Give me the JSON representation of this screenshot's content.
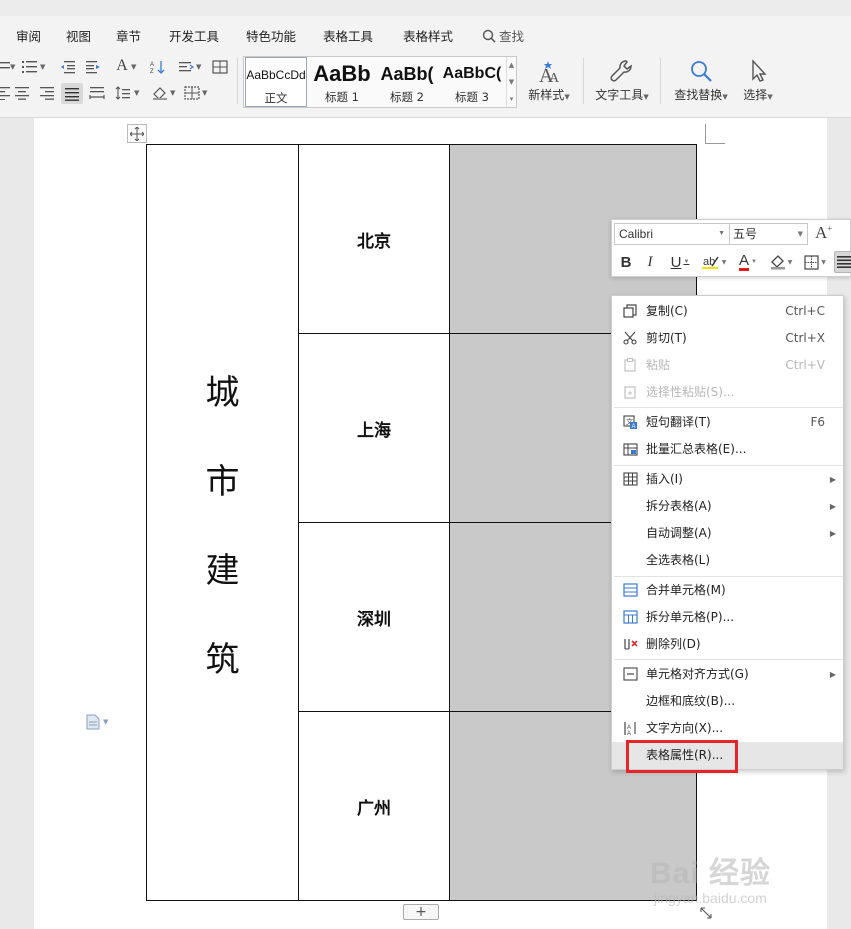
{
  "menu": {
    "tabs": [
      "审阅",
      "视图",
      "章节",
      "开发工具",
      "特色功能",
      "表格工具",
      "表格样式"
    ],
    "search_label": "查找"
  },
  "ribbon": {
    "styles": [
      {
        "sample": "AaBbCcDd",
        "name": "正文"
      },
      {
        "sample": "AaBb",
        "name": "标题 1"
      },
      {
        "sample": "AaBb(",
        "name": "标题 2"
      },
      {
        "sample": "AaBbC(",
        "name": "标题 3"
      }
    ],
    "new_style_label": "新样式",
    "text_tools_label": "文字工具",
    "find_replace_label": "查找替换",
    "select_label": "选择"
  },
  "document": {
    "merged_cell_chars": [
      "城",
      "市",
      "建",
      "筑"
    ],
    "cities": [
      "北京",
      "上海",
      "深圳",
      "广州"
    ],
    "add_row_label": "+"
  },
  "mini_toolbar": {
    "font_name": "Calibri",
    "font_size": "五号",
    "grow_font_label": "A",
    "bold_label": "B",
    "italic_label": "I",
    "underline_label": "U",
    "font_color_label": "A"
  },
  "context_menu": {
    "items": [
      {
        "label": "复制(C)",
        "shortcut": "Ctrl+C",
        "icon": "copy-icon",
        "disabled": false
      },
      {
        "label": "剪切(T)",
        "shortcut": "Ctrl+X",
        "icon": "scissors-icon",
        "disabled": false
      },
      {
        "label": "粘贴",
        "shortcut": "Ctrl+V",
        "icon": "paste-icon",
        "disabled": true
      },
      {
        "label": "选择性粘贴(S)...",
        "shortcut": "",
        "icon": "paste-special-icon",
        "disabled": true
      },
      {
        "label": "短句翻译(T)",
        "shortcut": "F6",
        "icon": "translate-icon",
        "disabled": false
      },
      {
        "label": "批量汇总表格(E)...",
        "shortcut": "",
        "icon": "summary-table-icon",
        "disabled": false
      },
      {
        "label": "插入(I)",
        "shortcut": "",
        "icon": "insert-table-icon",
        "submenu": true
      },
      {
        "label": "拆分表格(A)",
        "shortcut": "",
        "icon": "",
        "submenu": true
      },
      {
        "label": "自动调整(A)",
        "shortcut": "",
        "icon": "",
        "submenu": true
      },
      {
        "label": "全选表格(L)",
        "shortcut": "",
        "icon": ""
      },
      {
        "label": "合并单元格(M)",
        "shortcut": "",
        "icon": "merge-cells-icon"
      },
      {
        "label": "拆分单元格(P)...",
        "shortcut": "",
        "icon": "split-cells-icon"
      },
      {
        "label": "删除列(D)",
        "shortcut": "",
        "icon": "delete-column-icon"
      },
      {
        "label": "单元格对齐方式(G)",
        "shortcut": "",
        "icon": "cell-align-icon",
        "submenu": true
      },
      {
        "label": "边框和底纹(B)...",
        "shortcut": "",
        "icon": ""
      },
      {
        "label": "文字方向(X)...",
        "shortcut": "",
        "icon": "text-direction-icon"
      },
      {
        "label": "表格属性(R)...",
        "shortcut": "",
        "icon": "",
        "highlighted": true
      }
    ]
  },
  "watermark": {
    "brand": "Bai 经验",
    "domain": "jingyan.baidu.com"
  },
  "colors": {
    "highlight_box": "#e5252a",
    "gray_cell": "#c9c9c9"
  }
}
